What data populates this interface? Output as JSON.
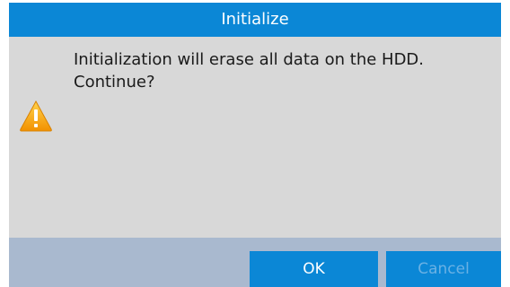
{
  "dialog": {
    "title": "Initialize",
    "message_line1": "Initialization will erase all data on the HDD.",
    "message_line2": "Continue?",
    "icon": "warning-icon",
    "ok_label": "OK",
    "cancel_label": "Cancel"
  },
  "colors": {
    "title_bar": "#0b87d6",
    "body": "#d8d8d8",
    "footer": "#a9b9cf",
    "button": "#0b87d6",
    "warning": "#f5a300"
  }
}
